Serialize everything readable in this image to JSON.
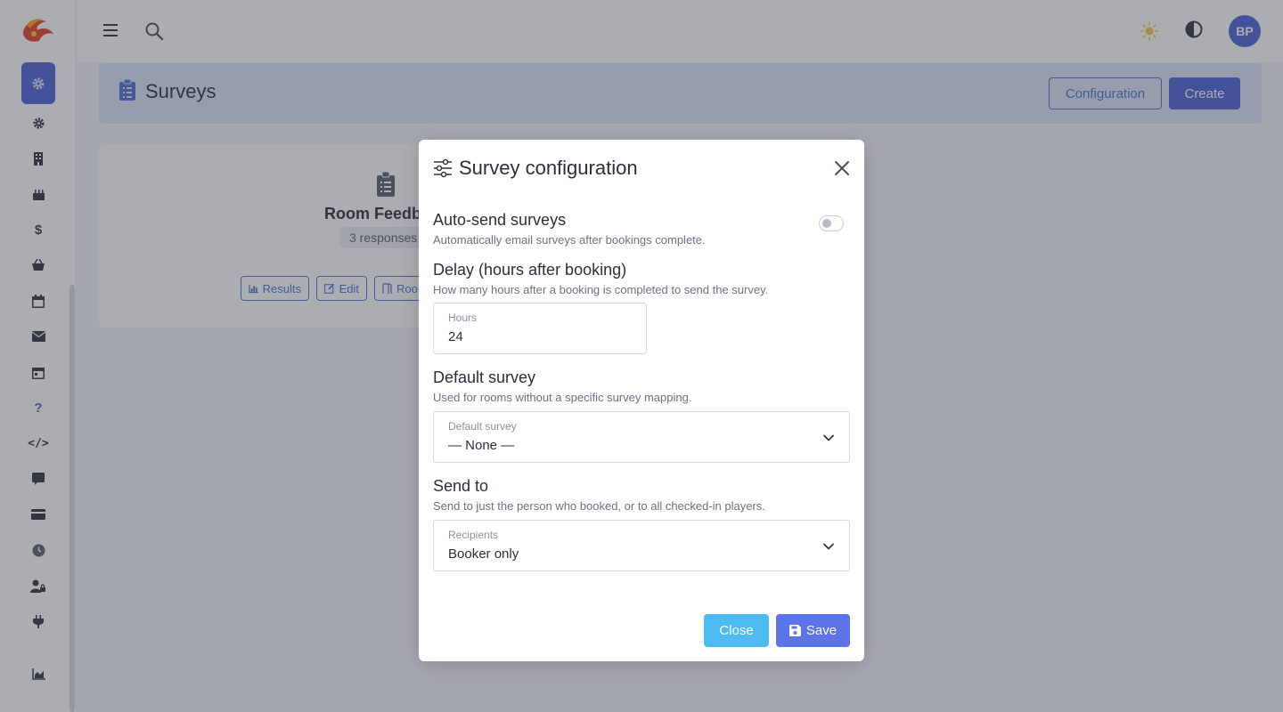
{
  "topbar": {
    "avatar_initials": "BP"
  },
  "page": {
    "title": "Surveys",
    "configuration_label": "Configuration",
    "create_label": "Create"
  },
  "survey_card": {
    "name": "Room Feedb",
    "responses": "3 responses",
    "buttons": [
      "Results",
      "Edit",
      "Roo"
    ]
  },
  "modal": {
    "title": "Survey configuration",
    "auto_send": {
      "title": "Auto-send surveys",
      "description": "Automatically email surveys after bookings complete.",
      "enabled": false
    },
    "delay": {
      "title": "Delay (hours after booking)",
      "description": "How many hours after a booking is completed to send the survey.",
      "field_label": "Hours",
      "value": "24"
    },
    "default_survey": {
      "title": "Default survey",
      "description": "Used for rooms without a specific survey mapping.",
      "field_label": "Default survey",
      "value": "— None —"
    },
    "send_to": {
      "title": "Send to",
      "description": "Send to just the person who booked, or to all checked-in players.",
      "field_label": "Recipients",
      "value": "Booker only"
    },
    "close_label": "Close",
    "save_label": "Save"
  },
  "colors": {
    "primary": "#4f63d8",
    "info": "#4dbbf2",
    "save": "#5b74e8"
  },
  "sidebar_icons": [
    "gear-icon",
    "building-icon",
    "cake-icon",
    "dollar-icon",
    "basket-icon",
    "calendar-icon",
    "envelope-icon",
    "calendar-day-icon",
    "question-icon",
    "code-icon",
    "chat-icon",
    "credit-card-icon",
    "clock-icon",
    "user-lock-icon",
    "plug-icon",
    "chart-area-icon"
  ]
}
